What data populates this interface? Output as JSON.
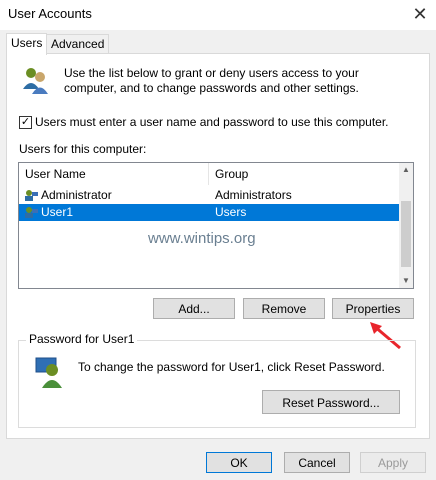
{
  "window": {
    "title": "User Accounts",
    "close_glyph": "✕"
  },
  "tabs": [
    {
      "label": "Users"
    },
    {
      "label": "Advanced"
    }
  ],
  "intro": {
    "text": "Use the list below to grant or deny users access to your computer, and to change passwords and other settings."
  },
  "require_login": {
    "checked": true,
    "label": "Users must enter a user name and password to use this computer."
  },
  "users_list": {
    "label": "Users for this computer:",
    "columns": [
      "User Name",
      "Group"
    ],
    "rows": [
      {
        "name": "Administrator",
        "group": "Administrators",
        "selected": false
      },
      {
        "name": "User1",
        "group": "Users",
        "selected": true
      }
    ]
  },
  "list_buttons": {
    "add": "Add...",
    "remove": "Remove",
    "properties": "Properties"
  },
  "watermark": "www.wintips.org",
  "password_group": {
    "title": "Password for User1",
    "text": "To change the password for User1, click Reset Password.",
    "reset_button": "Reset Password..."
  },
  "dialog_buttons": {
    "ok": "OK",
    "cancel": "Cancel",
    "apply": "Apply"
  },
  "colors": {
    "selection": "#0078d7",
    "annotation_arrow": "#e8252c"
  },
  "icons": {
    "window_close": "close-icon",
    "users": "users-icon",
    "user": "user-icon",
    "password": "password-user-icon"
  }
}
